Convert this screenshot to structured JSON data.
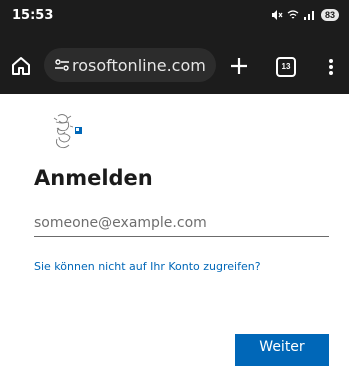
{
  "status_bar": {
    "time": "15:53",
    "battery": "83"
  },
  "browser": {
    "url": "rosoftonline.com",
    "tab_count": "13"
  },
  "login": {
    "title": "Anmelden",
    "email_placeholder": "someone@example.com",
    "email_value": "",
    "help_link": "Sie können nicht auf Ihr Konto zugreifen?",
    "next_button": "Weiter"
  },
  "colors": {
    "accent": "#0067b8",
    "toolbar": "#1c1c1c"
  }
}
